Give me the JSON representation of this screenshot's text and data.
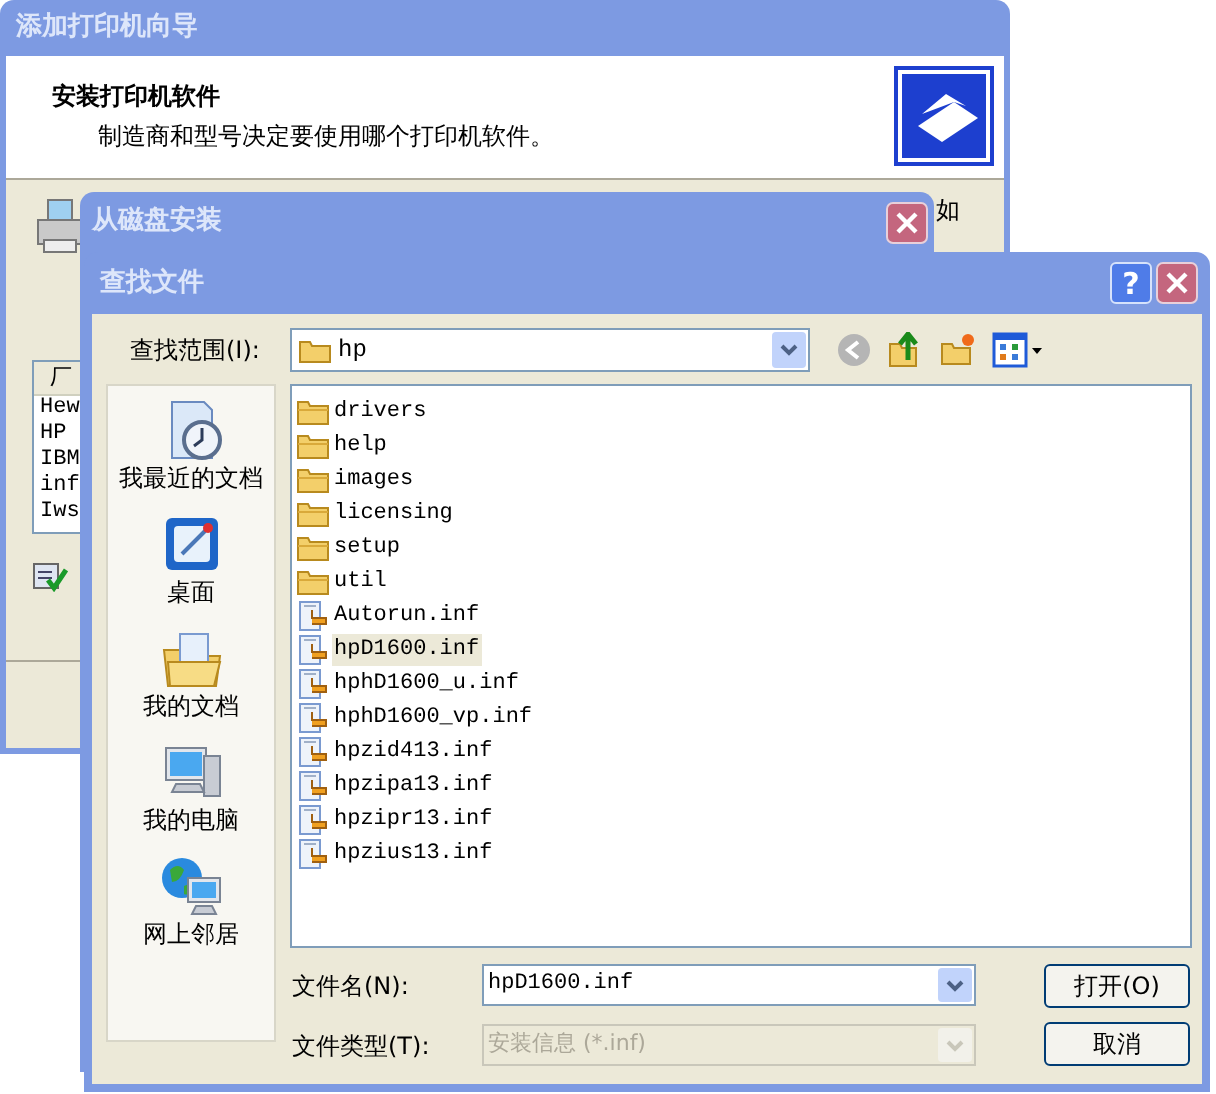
{
  "wizard": {
    "title": "添加打印机向导",
    "heading": "安装打印机软件",
    "subheading": "制造商和型号决定要使用哪个打印机软件。",
    "text_fragment": "如",
    "list_header": "厂",
    "list_rows": [
      "Hew",
      "HP",
      "IBM",
      "inf",
      "Iws"
    ]
  },
  "disk_dialog": {
    "title": "从磁盘安装"
  },
  "find_dialog": {
    "title": "查找文件",
    "help_button": "?",
    "look_in_label": "查找范围(I):",
    "look_in_value": "hp",
    "places": [
      {
        "label": "我最近的文档",
        "kind": "recent"
      },
      {
        "label": "桌面",
        "kind": "desktop"
      },
      {
        "label": "我的文档",
        "kind": "documents"
      },
      {
        "label": "我的电脑",
        "kind": "computer"
      },
      {
        "label": "网上邻居",
        "kind": "network"
      }
    ],
    "files": [
      {
        "name": "drivers",
        "kind": "folder",
        "selected": false
      },
      {
        "name": "help",
        "kind": "folder",
        "selected": false
      },
      {
        "name": "images",
        "kind": "folder",
        "selected": false
      },
      {
        "name": "licensing",
        "kind": "folder",
        "selected": false
      },
      {
        "name": "setup",
        "kind": "folder",
        "selected": false
      },
      {
        "name": "util",
        "kind": "folder",
        "selected": false
      },
      {
        "name": "Autorun.inf",
        "kind": "inf",
        "selected": false
      },
      {
        "name": "hpD1600.inf",
        "kind": "inf",
        "selected": true
      },
      {
        "name": "hphD1600_u.inf",
        "kind": "inf",
        "selected": false
      },
      {
        "name": "hphD1600_vp.inf",
        "kind": "inf",
        "selected": false
      },
      {
        "name": "hpzid413.inf",
        "kind": "inf",
        "selected": false
      },
      {
        "name": "hpzipa13.inf",
        "kind": "inf",
        "selected": false
      },
      {
        "name": "hpzipr13.inf",
        "kind": "inf",
        "selected": false
      },
      {
        "name": "hpzius13.inf",
        "kind": "inf",
        "selected": false
      }
    ],
    "file_name_label": "文件名(N):",
    "file_name_value": "hpD1600.inf",
    "file_type_label": "文件类型(T):",
    "file_type_value": "安装信息 (*.inf)",
    "file_type_disabled": true,
    "buttons": [
      "打开(O)",
      "取消"
    ]
  }
}
